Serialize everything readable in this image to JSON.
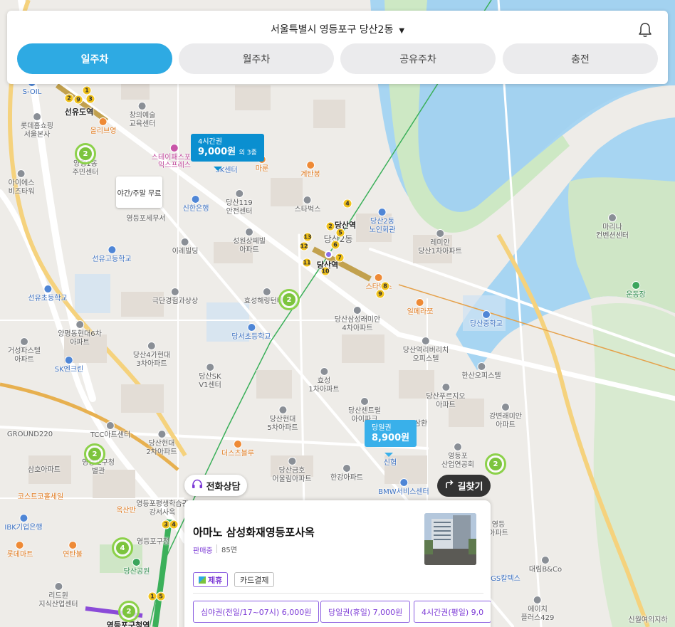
{
  "header": {
    "location": "서울특별시 영등포구 당산2동",
    "tabs": [
      {
        "label": "일주차",
        "active": true
      },
      {
        "label": "월주차",
        "active": false
      },
      {
        "label": "공유주차",
        "active": false
      },
      {
        "label": "충전",
        "active": false
      }
    ]
  },
  "map": {
    "price_tags": {
      "four_hour": {
        "title": "4시간권",
        "price": "9,000원",
        "extra": "외 3종"
      },
      "day": {
        "title": "당일권",
        "price": "8,900원"
      }
    },
    "free_note": "야간/주말 무료",
    "clusters": [
      "2",
      "2",
      "2",
      "4",
      "2",
      "2"
    ],
    "exits": [
      "1",
      "2",
      "3",
      "4",
      "5",
      "6",
      "7",
      "8",
      "9",
      "10",
      "11",
      "12",
      "13"
    ],
    "labels": {
      "soil": "S-OIL",
      "seonyudo_station": "선유도역",
      "olive_young": "올리브영",
      "lotte_home": "롯데홈쇼핑\n서울본사",
      "changui": "창의예술\n교육센터",
      "starbucks_top": "스타벅스",
      "yangpyeong": "양평1동\n주민센터",
      "ies": "아이에스\n비즈타워",
      "stay_pass": "스테이패스포트",
      "ex_press": "익스프레스",
      "sk_center": "SK센터",
      "maroon": "마룬",
      "gyetanbong": "계탄봉",
      "starbucks_mid": "스타벅스",
      "dangsan119": "당산119\n안전센터",
      "shinhan": "신한은행",
      "yd_tax": "영등포세무서",
      "eremilding": "이레빌딩",
      "seongwon": "성원상떼빌\n아파트",
      "dangsan_station_top": "당산역",
      "dangsan_2dong": "당산2동",
      "dangsan_station": "당산역",
      "dangsan_elderly": "당산2동\n노인회관",
      "remian_1": "레미안\n당산1차아파트",
      "seonyu_high": "선유고등학교",
      "seonyu_elem": "선유초등학교",
      "geukdan": "극단경험과상상",
      "hyoseong_haerington": "효성해링턴타워",
      "dangseo_elem": "당서초등학교",
      "sangsaeng_remian": "당산삼성래미안\n4차아파트",
      "starbucks_low": "스타벅스",
      "ilpyeong": "일페라쪼",
      "dangsan_middle": "당산중학교",
      "yangpyeong_hyundai": "양평동현대6차\n아파트",
      "geoseong": "거성파스텔\n아파트",
      "dangsan4_hyundai": "당산4가현대\n3차아파트",
      "dangsan_sk": "당산SK\nV1센터",
      "sk_encrean": "SK엔크린",
      "hyoseong_1": "효성\n1차아파트",
      "riverchi": "당산역리버리치\n오피스텔",
      "hansan_office": "한산오피스텔",
      "puruji": "당산푸르지오\n아파트",
      "gangbyeon_remian": "강변래미안\n아파트",
      "ground220": "GROUND220",
      "tcc": "TCC아트센터",
      "dangsan_hyundai5": "당산현대\n5차아파트",
      "dangsan_central": "당산센트럴\n아이파크",
      "samhwan": "삼환",
      "dangsan_hyundai2": "당산현대\n2차아파트",
      "the_sports": "더스츠블루",
      "samho": "삼호아파트",
      "yd_office": "영등포구청\n별관",
      "coast_cold": "코스트코홀세일",
      "dangsan_geumho": "당산금호\n어울림아파트",
      "hangang_apt": "한강아파트",
      "shinhyeop": "신협",
      "yd_industry": "영등포\n산업연공회",
      "bmw": "BMW서비스센터",
      "oksanban": "옥산반",
      "yd_library": "영등포평생학습관\n강서사옥",
      "ibk": "IBK기업은행",
      "lotte_mart": "롯데마트",
      "yeontanbul": "연탄불",
      "yd_gucheong": "영등포구청",
      "dangsan_park": "당산공원",
      "yd_gucheong_station": "영등포구청역",
      "lead_center": "리드원\n지식산업센터",
      "mariana": "마리나\n컨벤션센터",
      "stadium": "운동장",
      "yd_elem": "영등\n아파트",
      "daerim": "대림B&Co",
      "gs_caltex": "GS칼텍스",
      "acey": "에이치\n플러스429",
      "sinwol": "신월여의지하"
    }
  },
  "buttons": {
    "call": "전화상담",
    "route": "길찾기"
  },
  "card": {
    "name": "아마노 삼성화재영등포사옥",
    "status": "판매중",
    "spaces": "85면",
    "badges": {
      "partner": "제휴",
      "card": "카드결제"
    },
    "prices": [
      "심야권(전일/17~07시) 6,000원",
      "당일권(휴일) 7,000원",
      "4시간권(평일) 9,0"
    ]
  },
  "colors": {
    "accent": "#2eaae3",
    "purple": "#7c3ad6",
    "cluster": "#7cc43d"
  }
}
